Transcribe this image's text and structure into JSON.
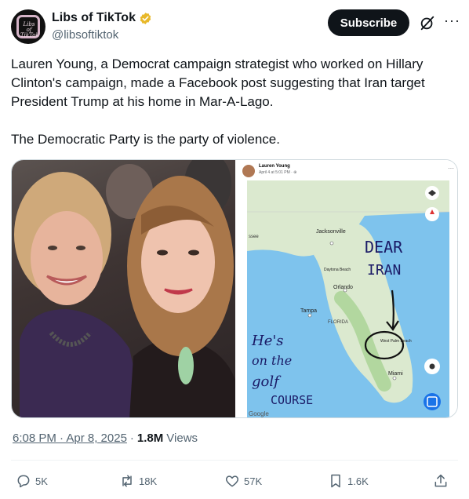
{
  "account": {
    "display_name": "Libs of TikTok",
    "handle": "@libsoftiktok",
    "avatar_text": "Libs of TikTok",
    "verified_color": "#e8b829"
  },
  "header": {
    "subscribe_label": "Subscribe",
    "more_label": "···"
  },
  "tweet": {
    "paragraph_1": "Lauren Young, a Democrat campaign strategist who worked on Hillary Clinton's campaign, made a Facebook post suggesting that Iran target President Trump at his home in Mar-A-Lago.",
    "paragraph_2": "The Democratic Party is the party of violence."
  },
  "facebook_post": {
    "author": "Lauren Young",
    "date": "April 4 at 5:01 PM · ⊕",
    "more": "···",
    "map": {
      "labels": [
        "Jacksonville",
        "Daytona Beach",
        "Orlando",
        "Tampa",
        "FLORIDA",
        "West Palm Beach",
        "Miami",
        "Google",
        "ssee"
      ],
      "handwriting_top_1": "DEAR",
      "handwriting_top_2": "IRAN",
      "handwriting_bottom_1": "He's",
      "handwriting_bottom_2": "on the",
      "handwriting_bottom_3": "golf",
      "handwriting_bottom_4": "COURSE"
    }
  },
  "meta": {
    "time": "6:08 PM · Apr 8, 2025",
    "separator": "·",
    "views_count": "1.8M",
    "views_label": "Views"
  },
  "actions": {
    "replies": "5K",
    "reposts": "18K",
    "likes": "57K",
    "bookmarks": "1.6K"
  },
  "colors": {
    "text": "#0f1419",
    "secondary": "#536471",
    "map_water": "#7ec3ed",
    "map_land": "#dbe9cf",
    "accent_blue": "#1d9bf0"
  }
}
